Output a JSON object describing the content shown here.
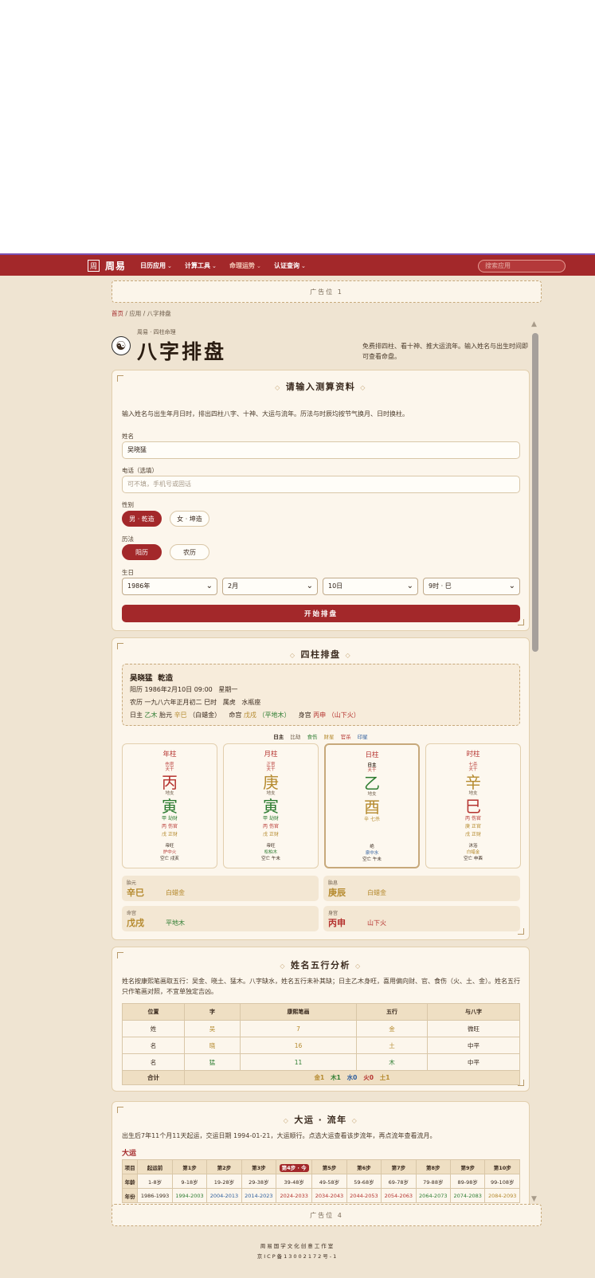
{
  "nav": {
    "logo_char": "周",
    "brand": "周易",
    "items": [
      {
        "label": "日历应用"
      },
      {
        "label": "计算工具"
      },
      {
        "label": "命理运势"
      },
      {
        "label": "认证查询"
      }
    ],
    "search_placeholder": "搜索应用"
  },
  "ads": {
    "top": "广告位 1",
    "bottom": "广告位 4"
  },
  "breadcrumb": {
    "home": "首页",
    "sep": "/",
    "app": "应用",
    "current": "八字排盘"
  },
  "header": {
    "small": "周易 · 四柱命理",
    "title": "八字排盘",
    "desc": "免费排四柱、看十神、推大运流年。输入姓名与出生时间即可查看命盘。"
  },
  "form": {
    "title": "请输入测算资料",
    "intro": "输入姓名与出生年月日时，排出四柱八字、十神、大运与流年。历法与时辰均按节气换月、日时换柱。",
    "name_label": "姓名",
    "name_value": "吴晓猛",
    "phone_label": "电话（选填）",
    "phone_placeholder": "可不填，手机号或固话",
    "gender_label": "性别",
    "gender_male": "男 · 乾造",
    "gender_female": "女 · 坤造",
    "calendar_label": "历法",
    "cal_solar": "阳历",
    "cal_lunar": "农历",
    "birth_label": "生日",
    "year": "1986年",
    "month": "2月",
    "day": "10日",
    "hour": "9时 · 巳",
    "submit": "开始排盘"
  },
  "chart": {
    "title": "四柱排盘",
    "name": "吴晓猛",
    "gender": "乾造",
    "solar": "阳历 1986年2月10日 09:00",
    "weekday": "星期一",
    "lunar": "农历 一九八六年正月初二 巳时",
    "zodiac": "属虎",
    "constellation": "水瓶座",
    "day_master_label": "日主",
    "day_master": "乙木",
    "yuan_label": "胎元",
    "yuan_val": "辛巳",
    "yuan_nayin": "（白蜡金）",
    "ming_label": "命宫",
    "ming_val": "戊戌",
    "ming_nayin": "（平地木）",
    "shen_label": "身宫",
    "shen_val": "丙申",
    "shen_nayin": "（山下火）",
    "legend": [
      "日主",
      "比劫",
      "食伤",
      "财星",
      "官杀",
      "印星"
    ],
    "pillars": [
      {
        "title": "年柱",
        "god": "伤官",
        "god2": "天干",
        "stem": "丙",
        "branch_label": "地支",
        "branch": "寅",
        "hidden": [
          "甲 劫财",
          "丙 伤官",
          "戊 正财"
        ],
        "extra": [
          "帝旺",
          "炉中火",
          "空亡 戌亥"
        ]
      },
      {
        "title": "月柱",
        "god": "正官",
        "god2": "天干",
        "stem": "庚",
        "branch_label": "地支",
        "branch": "寅",
        "hidden": [
          "甲 劫财",
          "丙 伤官",
          "戊 正财"
        ],
        "extra": [
          "帝旺",
          "松柏木",
          "空亡 午未"
        ]
      },
      {
        "title": "日柱",
        "god": "日主",
        "god2": "天干",
        "stem": "乙",
        "branch_label": "地支",
        "branch": "酉",
        "hidden": [
          "辛 七杀"
        ],
        "extra": [
          "绝",
          "泉中水",
          "空亡 午未"
        ]
      },
      {
        "title": "时柱",
        "god": "七杀",
        "god2": "天干",
        "stem": "辛",
        "branch_label": "地支",
        "branch": "巳",
        "hidden": [
          "丙 伤官",
          "庚 正官",
          "戊 正财"
        ],
        "extra": [
          "沐浴",
          "白蜡金",
          "空亡 申酉"
        ]
      }
    ],
    "boxes": [
      {
        "label": "胎元",
        "value": "辛巳",
        "sub": "白蜡金"
      },
      {
        "label": "胎息",
        "value": "庚辰",
        "sub": "白蜡金"
      },
      {
        "label": "命宫",
        "value": "戊戌",
        "sub": "平地木"
      },
      {
        "label": "身宫",
        "value": "丙申",
        "sub": "山下火"
      }
    ]
  },
  "name_analysis": {
    "title": "姓名五行分析",
    "intro": "姓名按康熙笔画取五行：吴金、晓土、猛木。八字缺水，姓名五行未补其缺；日主乙木身旺，喜用偏向财、官、食伤（火、土、金）。姓名五行只作笔画对照，不宜单独定吉凶。",
    "headers": [
      "位置",
      "字",
      "康熙笔画",
      "五行",
      "与八字"
    ],
    "rows": [
      {
        "pos": "姓",
        "char": "吴",
        "strokes": "7",
        "element": "金",
        "relation": "微旺"
      },
      {
        "pos": "名",
        "char": "晓",
        "strokes": "16",
        "element": "土",
        "relation": "中平"
      },
      {
        "pos": "名",
        "char": "猛",
        "strokes": "11",
        "element": "木",
        "relation": "中平"
      }
    ],
    "total_label": "合计",
    "totals": [
      "金1",
      "木1",
      "水0",
      "火0",
      "土1"
    ]
  },
  "dayun": {
    "title": "大运 · 流年",
    "intro": "出生后7年11个月11天起运，交运日期 1994-01-21，大运顺行。点选大运查看该步流年，再点流年查看流月。",
    "section": "大运",
    "head": [
      "项目",
      "起运前",
      "第1步",
      "第2步",
      "第3步",
      "第4步 · 今",
      "第5步",
      "第6步",
      "第7步",
      "第8步",
      "第9步",
      "第10步"
    ],
    "age_label": "年龄",
    "ages": [
      "1-8岁",
      "9-18岁",
      "19-28岁",
      "29-38岁",
      "39-48岁",
      "49-58岁",
      "59-68岁",
      "69-78岁",
      "79-88岁",
      "89-98岁",
      "99-108岁"
    ],
    "year_label": "年份",
    "years": [
      "1986-1993",
      "1994-2003",
      "2004-2013",
      "2014-2023",
      "2024-2033",
      "2034-2043",
      "2044-2053",
      "2054-2063",
      "2064-2073",
      "2074-2083",
      "2084-2093"
    ]
  },
  "footer": {
    "org": "周易国学文化创意工作室",
    "icp": "京ICP备13002172号-1"
  },
  "colors": {
    "brand": "#a3282a",
    "wood": "#2e7d32",
    "fire": "#b5332f",
    "earth": "#b58a2e",
    "water": "#2f5f9e"
  }
}
